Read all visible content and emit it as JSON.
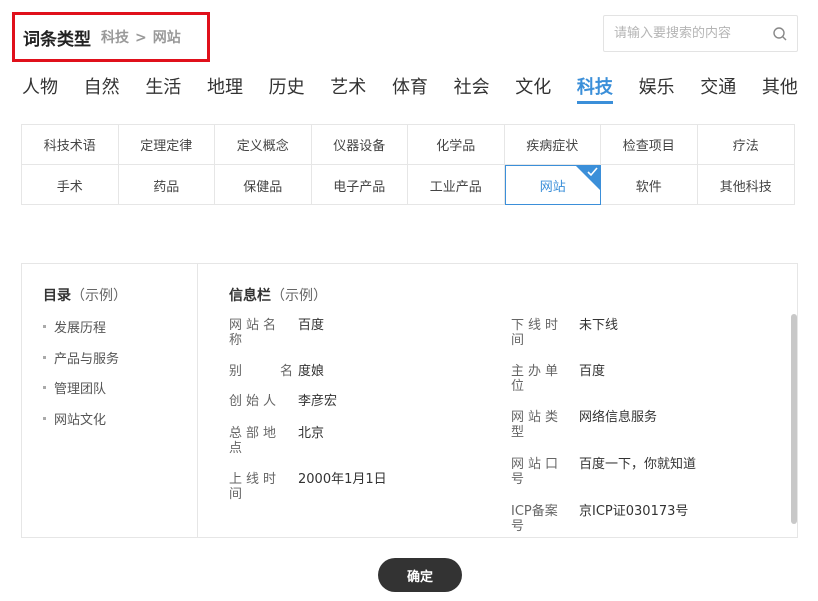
{
  "header": {
    "title": "词条类型",
    "crumb_category": "科技",
    "crumb_sep": ">",
    "crumb_sub": "网站"
  },
  "search": {
    "placeholder": "请输入要搜索的内容",
    "value": ""
  },
  "categories": [
    "人物",
    "自然",
    "生活",
    "地理",
    "历史",
    "艺术",
    "体育",
    "社会",
    "文化",
    "科技",
    "娱乐",
    "交通",
    "其他"
  ],
  "active_category": "科技",
  "subcategories": [
    "科技术语",
    "定理定律",
    "定义概念",
    "仪器设备",
    "化学品",
    "疾病症状",
    "检查项目",
    "疗法",
    "手术",
    "药品",
    "保健品",
    "电子产品",
    "工业产品",
    "网站",
    "软件",
    "其他科技"
  ],
  "active_subcategory": "网站",
  "toc": {
    "title": "目录",
    "example": "（示例）",
    "items": [
      "发展历程",
      "产品与服务",
      "管理团队",
      "网站文化"
    ]
  },
  "infobox": {
    "title": "信息栏",
    "example": "（示例）",
    "left": [
      {
        "label": "网站名称",
        "value": "百度"
      },
      {
        "label": "别　　名",
        "value": "度娘"
      },
      {
        "label": "创始人",
        "value": "李彦宏"
      },
      {
        "label": "总部地点",
        "value": "北京"
      },
      {
        "label": "上线时间",
        "value": "2000年1月1日"
      }
    ],
    "right": [
      {
        "label": "下线时间",
        "value": "未下线"
      },
      {
        "label": "主办单位",
        "value": "百度"
      },
      {
        "label": "网站类型",
        "value": "网络信息服务"
      },
      {
        "label": "网站口号",
        "value": "百度一下，你就知道"
      },
      {
        "label": "ICP备案号",
        "value": "京ICP证030173号"
      }
    ]
  },
  "confirm_label": "确定",
  "colors": {
    "accent": "#3b8fd9",
    "highlight_border": "#e0101b",
    "button_bg": "#333333"
  }
}
